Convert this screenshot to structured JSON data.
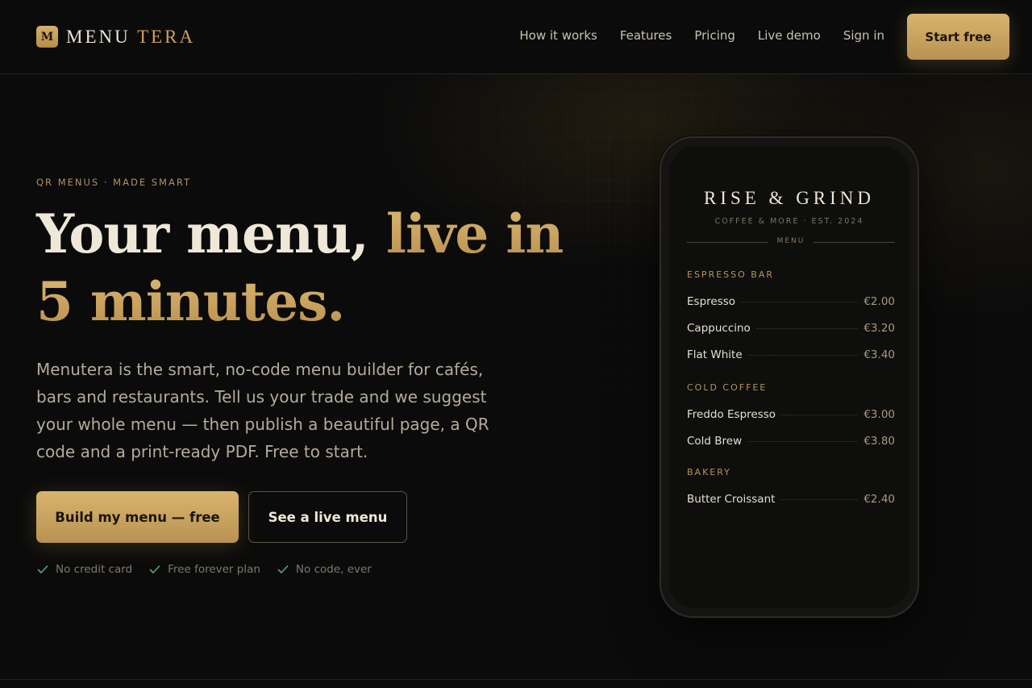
{
  "brand": {
    "mark": "M",
    "name_part1": "MENU",
    "name_part2": "TERA"
  },
  "nav": {
    "items": [
      "How it works",
      "Features",
      "Pricing",
      "Live demo",
      "Sign in"
    ],
    "cta": "Start free"
  },
  "hero": {
    "eyebrow": "QR MENUS · MADE SMART",
    "headline_plain": "Your menu, ",
    "headline_gold_1": "live in",
    "headline_gold_2": "5 minutes.",
    "lede": "Menutera is the smart, no-code menu builder for cafés, bars and restaurants. Tell us your trade and we suggest your whole menu — then publish a beautiful page, a QR code and a print-ready PDF. Free to start.",
    "primary_cta": "Build my menu — free",
    "secondary_cta": "See a live menu",
    "checks": [
      "No credit card",
      "Free forever plan",
      "No code, ever"
    ]
  },
  "phone_menu": {
    "name": "RISE & GRIND",
    "tagline": "COFFEE & MORE · EST. 2024",
    "menu_label": "MENU",
    "sections": [
      {
        "title": "ESPRESSO BAR",
        "items": [
          {
            "name": "Espresso",
            "price": "€2.00"
          },
          {
            "name": "Cappuccino",
            "price": "€3.20"
          },
          {
            "name": "Flat White",
            "price": "€3.40"
          }
        ]
      },
      {
        "title": "COLD COFFEE",
        "items": [
          {
            "name": "Freddo Espresso",
            "price": "€3.00"
          },
          {
            "name": "Cold Brew",
            "price": "€3.80"
          }
        ]
      },
      {
        "title": "BAKERY",
        "items": [
          {
            "name": "Butter Croissant",
            "price": "€2.40"
          }
        ]
      }
    ]
  },
  "colors": {
    "background": "#0b0b0b",
    "accent_gold": "#c9a25e",
    "check_green": "#5fa07a"
  },
  "icons": {
    "check": "check-icon",
    "logo": "logo-mark"
  }
}
